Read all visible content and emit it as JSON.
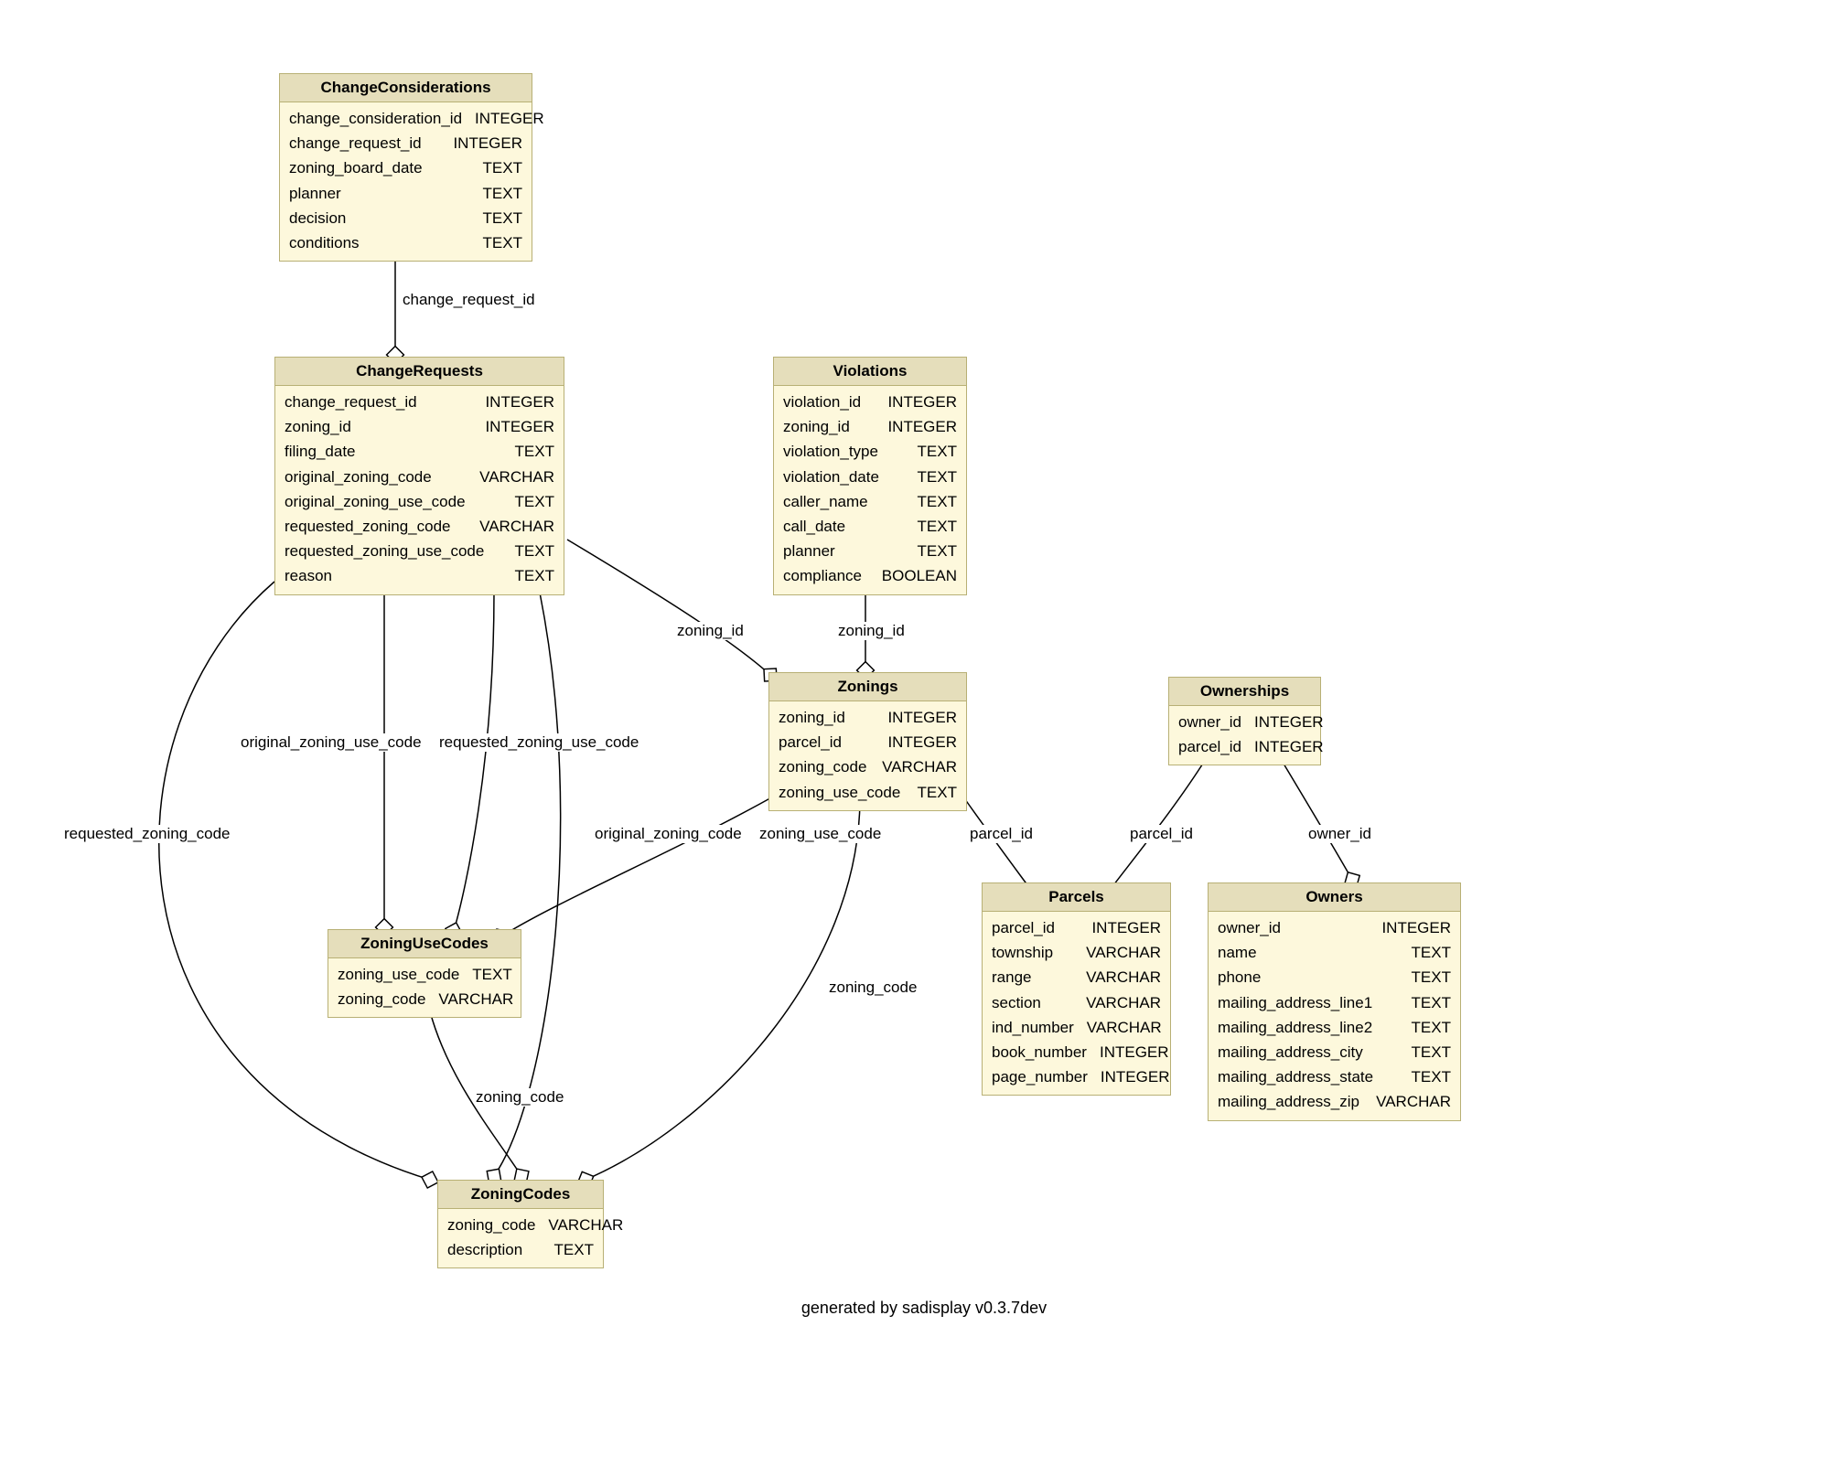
{
  "footer": "generated by sadisplay v0.3.7dev",
  "tables": {
    "ChangeConsiderations": {
      "title": "ChangeConsiderations",
      "cols": [
        {
          "name": "change_consideration_id",
          "type": "INTEGER"
        },
        {
          "name": "change_request_id",
          "type": "INTEGER"
        },
        {
          "name": "zoning_board_date",
          "type": "TEXT"
        },
        {
          "name": "planner",
          "type": "TEXT"
        },
        {
          "name": "decision",
          "type": "TEXT"
        },
        {
          "name": "conditions",
          "type": "TEXT"
        }
      ]
    },
    "ChangeRequests": {
      "title": "ChangeRequests",
      "cols": [
        {
          "name": "change_request_id",
          "type": "INTEGER"
        },
        {
          "name": "zoning_id",
          "type": "INTEGER"
        },
        {
          "name": "filing_date",
          "type": "TEXT"
        },
        {
          "name": "original_zoning_code",
          "type": "VARCHAR"
        },
        {
          "name": "original_zoning_use_code",
          "type": "TEXT"
        },
        {
          "name": "requested_zoning_code",
          "type": "VARCHAR"
        },
        {
          "name": "requested_zoning_use_code",
          "type": "TEXT"
        },
        {
          "name": "reason",
          "type": "TEXT"
        }
      ]
    },
    "Violations": {
      "title": "Violations",
      "cols": [
        {
          "name": "violation_id",
          "type": "INTEGER"
        },
        {
          "name": "zoning_id",
          "type": "INTEGER"
        },
        {
          "name": "violation_type",
          "type": "TEXT"
        },
        {
          "name": "violation_date",
          "type": "TEXT"
        },
        {
          "name": "caller_name",
          "type": "TEXT"
        },
        {
          "name": "call_date",
          "type": "TEXT"
        },
        {
          "name": "planner",
          "type": "TEXT"
        },
        {
          "name": "compliance",
          "type": "BOOLEAN"
        }
      ]
    },
    "Zonings": {
      "title": "Zonings",
      "cols": [
        {
          "name": "zoning_id",
          "type": "INTEGER"
        },
        {
          "name": "parcel_id",
          "type": "INTEGER"
        },
        {
          "name": "zoning_code",
          "type": "VARCHAR"
        },
        {
          "name": "zoning_use_code",
          "type": "TEXT"
        }
      ]
    },
    "Ownerships": {
      "title": "Ownerships",
      "cols": [
        {
          "name": "owner_id",
          "type": "INTEGER"
        },
        {
          "name": "parcel_id",
          "type": "INTEGER"
        }
      ]
    },
    "ZoningUseCodes": {
      "title": "ZoningUseCodes",
      "cols": [
        {
          "name": "zoning_use_code",
          "type": "TEXT"
        },
        {
          "name": "zoning_code",
          "type": "VARCHAR"
        }
      ]
    },
    "Parcels": {
      "title": "Parcels",
      "cols": [
        {
          "name": "parcel_id",
          "type": "INTEGER"
        },
        {
          "name": "township",
          "type": "VARCHAR"
        },
        {
          "name": "range",
          "type": "VARCHAR"
        },
        {
          "name": "section",
          "type": "VARCHAR"
        },
        {
          "name": "ind_number",
          "type": "VARCHAR"
        },
        {
          "name": "book_number",
          "type": "INTEGER"
        },
        {
          "name": "page_number",
          "type": "INTEGER"
        }
      ]
    },
    "Owners": {
      "title": "Owners",
      "cols": [
        {
          "name": "owner_id",
          "type": "INTEGER"
        },
        {
          "name": "name",
          "type": "TEXT"
        },
        {
          "name": "phone",
          "type": "TEXT"
        },
        {
          "name": "mailing_address_line1",
          "type": "TEXT"
        },
        {
          "name": "mailing_address_line2",
          "type": "TEXT"
        },
        {
          "name": "mailing_address_city",
          "type": "TEXT"
        },
        {
          "name": "mailing_address_state",
          "type": "TEXT"
        },
        {
          "name": "mailing_address_zip",
          "type": "VARCHAR"
        }
      ]
    },
    "ZoningCodes": {
      "title": "ZoningCodes",
      "cols": [
        {
          "name": "zoning_code",
          "type": "VARCHAR"
        },
        {
          "name": "description",
          "type": "TEXT"
        }
      ]
    }
  },
  "edgeLabels": {
    "change_request_id": "change_request_id",
    "zoning_id_cr": "zoning_id",
    "zoning_id_v": "zoning_id",
    "original_zoning_use_code": "original_zoning_use_code",
    "requested_zoning_use_code": "requested_zoning_use_code",
    "requested_zoning_code": "requested_zoning_code",
    "original_zoning_code": "original_zoning_code",
    "zoning_use_code": "zoning_use_code",
    "zoning_code_z": "zoning_code",
    "zoning_code_uc": "zoning_code",
    "parcel_id_z": "parcel_id",
    "parcel_id_o": "parcel_id",
    "owner_id": "owner_id"
  }
}
